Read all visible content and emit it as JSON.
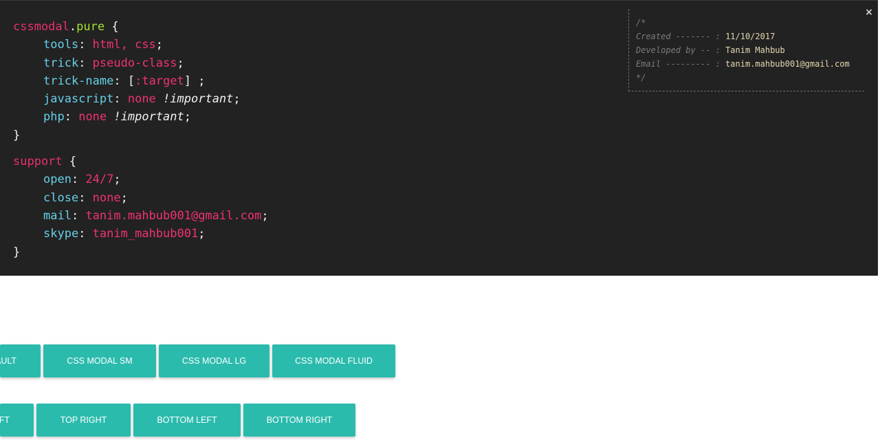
{
  "modal": {
    "close_icon": "×",
    "code": {
      "block1": {
        "selector": "cssmodal",
        "dot": ".",
        "class": "pure",
        "open": " {",
        "lines": [
          {
            "prop": "tools",
            "val": "html, css",
            "end": ";"
          },
          {
            "prop": "trick",
            "val": "pseudo-class",
            "end": ";"
          },
          {
            "prop": "trick-name",
            "pre": "[",
            "val": ":target",
            "post": "] ;"
          },
          {
            "prop": "javascript",
            "val": "none",
            "imp": "!important",
            "end": ";"
          },
          {
            "prop": "php",
            "val": "none",
            "imp": "!important",
            "end": ";"
          }
        ],
        "close": "}"
      },
      "block2": {
        "selector": "support",
        "open": " {",
        "lines": [
          {
            "prop": "open",
            "val": "24/7",
            "end": ";"
          },
          {
            "prop": "close",
            "val": "none",
            "end": ";"
          },
          {
            "prop": "mail",
            "val": "tanim.mahbub001@gmail.com",
            "end": ";"
          },
          {
            "prop": "skype",
            "val": "tanim_mahbub001",
            "end": ";"
          }
        ],
        "close": "}"
      },
      "colon": ": "
    },
    "comment": {
      "open": "/*",
      "created_key": "Created ------- :",
      "created_val": "11/10/2017",
      "dev_key": "Developed by -- :",
      "dev_val": "Tanim Mahbub",
      "email_key": "Email --------- :",
      "email_val": "tanim.mahbub001@gmail.com",
      "close": "*/"
    }
  },
  "buttons": {
    "row1": [
      "AULT",
      "CSS MODAL SM",
      "CSS MODAL LG",
      "CSS MODAL FLUID"
    ],
    "row2": [
      "FT",
      "TOP RIGHT",
      "BOTTOM LEFT",
      "BOTTOM RIGHT"
    ]
  },
  "colors": {
    "modal_bg": "#222222",
    "selector": "#e8316f",
    "class": "#a6e22e",
    "property": "#66d0e9",
    "value": "#f0336f",
    "button": "#2bbbad"
  }
}
